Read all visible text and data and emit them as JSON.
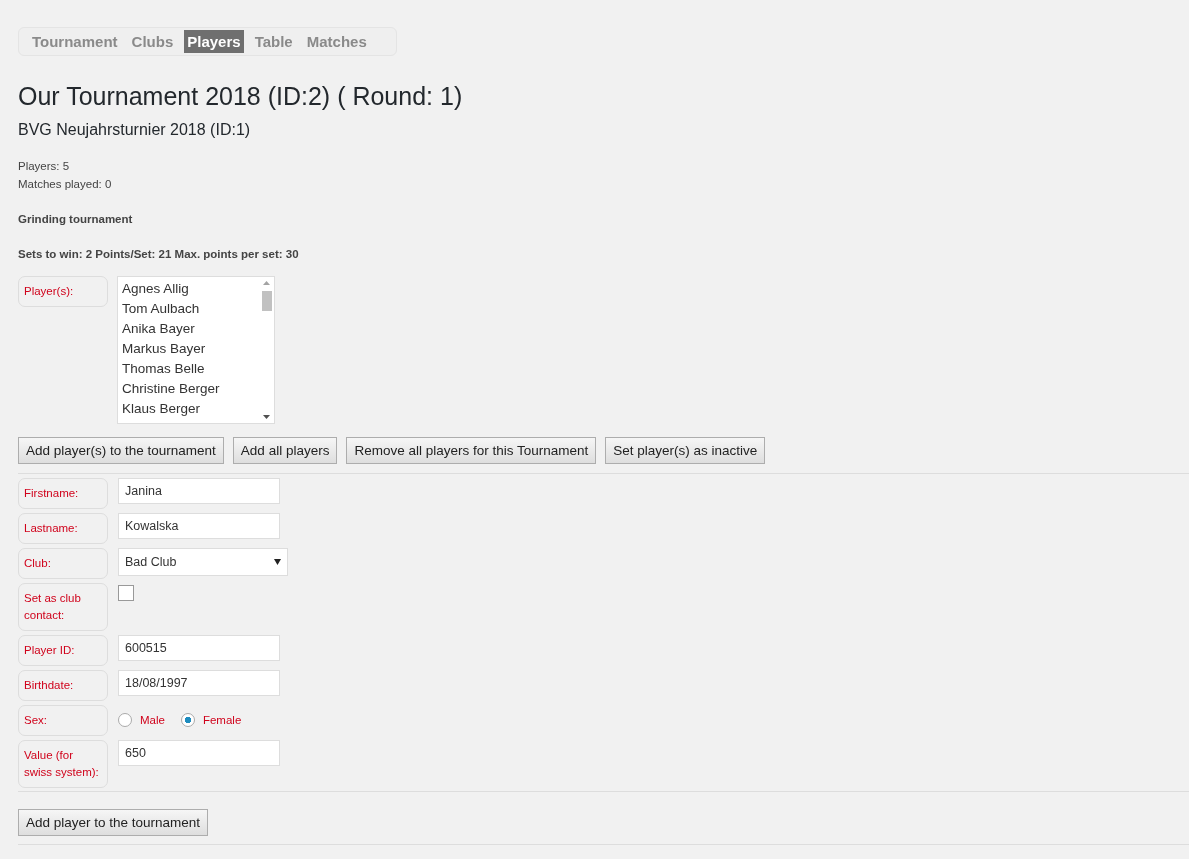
{
  "tabs": [
    {
      "label": "Tournament",
      "selected": false
    },
    {
      "label": "Clubs",
      "selected": false
    },
    {
      "label": "Players",
      "selected": true
    },
    {
      "label": "Table",
      "selected": false
    },
    {
      "label": "Matches",
      "selected": false
    }
  ],
  "title": "Our Tournament 2018 (ID:2) ( Round: 1)",
  "subtitle": "BVG Neujahrsturnier 2018 (ID:1)",
  "stats": [
    "Players: 5",
    "Matches played: 0"
  ],
  "mode": "Grinding tournament",
  "settings": "Sets to win: 2 Points/Set: 21 Max. points per set: 30",
  "player_list": {
    "label": "Player(s):",
    "items": [
      "Agnes Allig",
      "Tom Aulbach",
      "Anika Bayer",
      "Markus Bayer",
      "Thomas Belle",
      "Christine Berger",
      "Klaus Berger"
    ]
  },
  "list_buttons": [
    "Add player(s) to the tournament",
    "Add all players",
    "Remove all players for this Tournament",
    "Set player(s) as inactive"
  ],
  "form": [
    {
      "kind": "text",
      "label": "Firstname:",
      "value": "Janina"
    },
    {
      "kind": "text",
      "label": "Lastname:",
      "value": "Kowalska"
    },
    {
      "kind": "select",
      "label": "Club:",
      "value": "Bad Club"
    },
    {
      "kind": "checkbox",
      "label": "Set as club contact:",
      "checked": false
    },
    {
      "kind": "text",
      "label": "Player ID:",
      "value": "600515"
    },
    {
      "kind": "text",
      "label": "Birthdate:",
      "value": "18/08/1997"
    },
    {
      "kind": "radio",
      "label": "Sex:",
      "options": [
        {
          "label": "Male",
          "selected": false
        },
        {
          "label": "Female",
          "selected": true
        }
      ]
    },
    {
      "kind": "text",
      "label": "Value (for swiss system):",
      "value": "650"
    }
  ],
  "submit_button": "Add player to the tournament"
}
